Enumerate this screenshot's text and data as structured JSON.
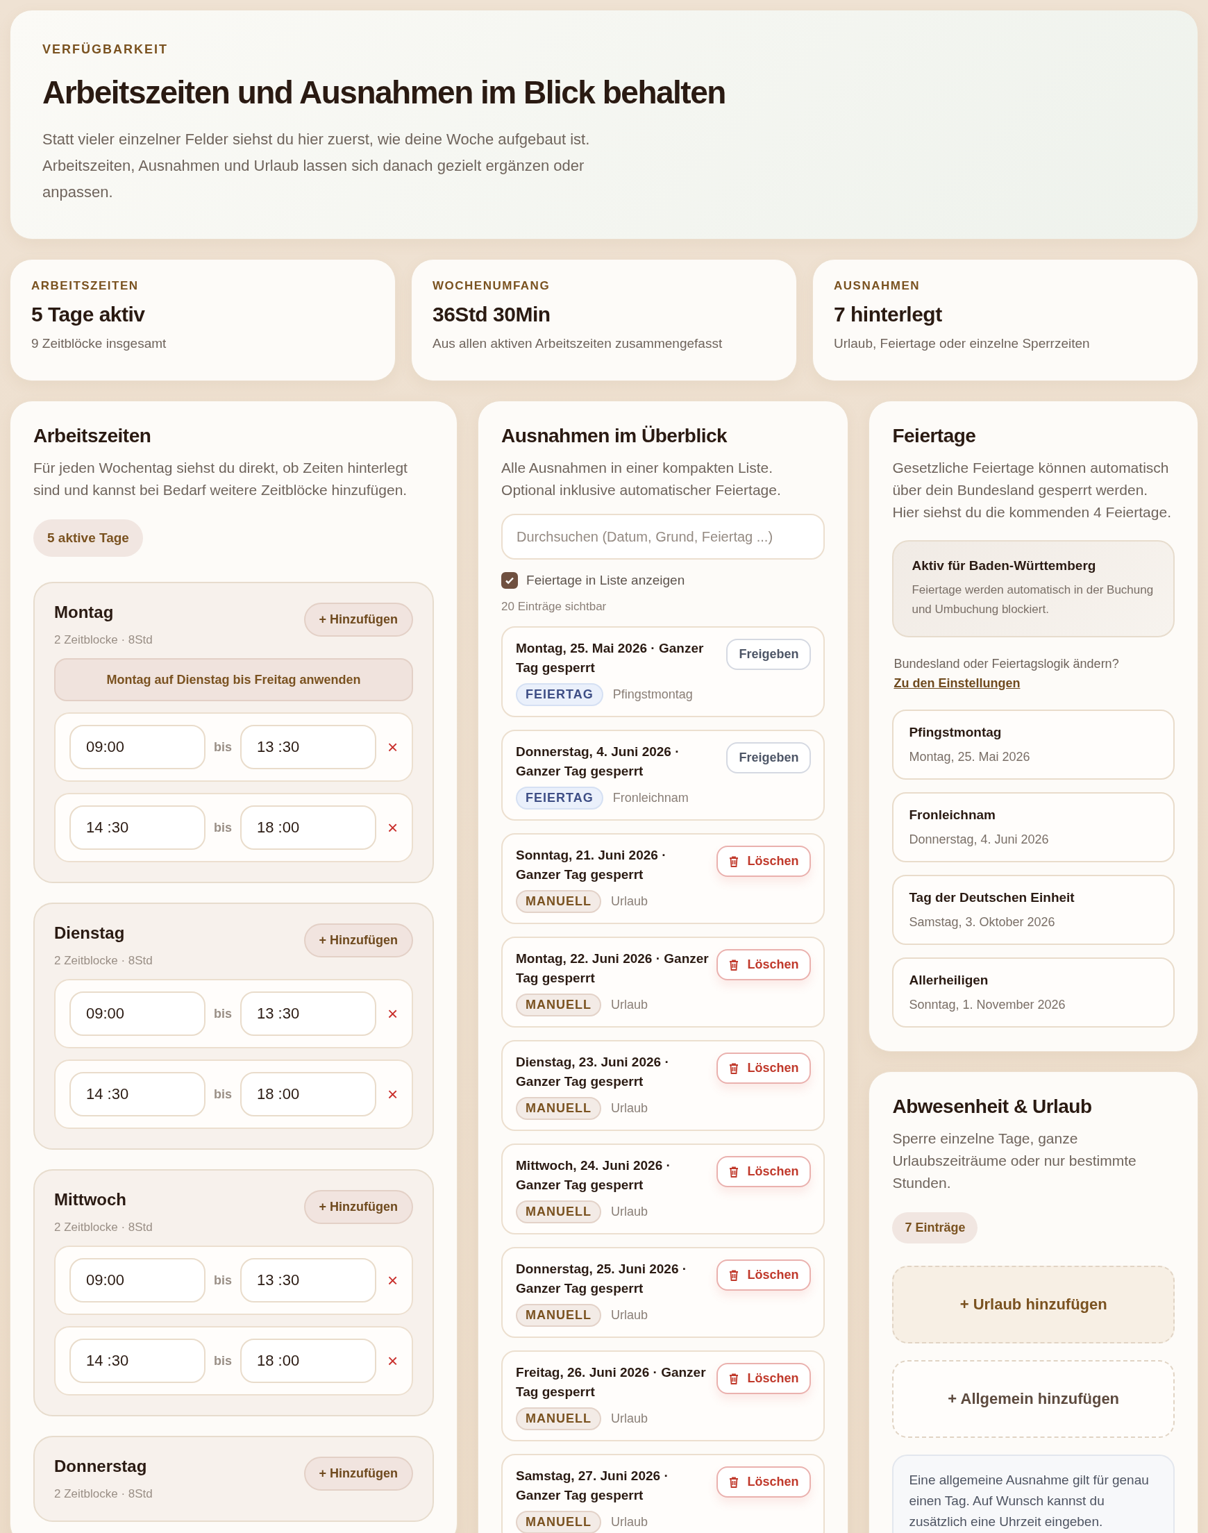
{
  "hero": {
    "eyebrow": "VERFÜGBARKEIT",
    "title": "Arbeitszeiten und Ausnahmen im Blick behalten",
    "description": "Statt vieler einzelner Felder siehst du hier zuerst, wie deine Woche aufgebaut ist. Arbeitszeiten, Ausnahmen und Urlaub lassen sich danach gezielt ergänzen oder anpassen."
  },
  "stats": [
    {
      "label": "ARBEITSZEITEN",
      "value": "5 Tage aktiv",
      "note": "9 Zeitblöcke insgesamt"
    },
    {
      "label": "WOCHENUMFANG",
      "value": "36Std 30Min",
      "note": "Aus allen aktiven Arbeitszeiten zusammengefasst"
    },
    {
      "label": "AUSNAHMEN",
      "value": "7 hinterlegt",
      "note": "Urlaub, Feiertage oder einzelne Sperrzeiten"
    }
  ],
  "working_hours": {
    "title": "Arbeitszeiten",
    "description": "Für jeden Wochentag siehst du direkt, ob Zeiten hinterlegt sind und kannst bei Bedarf weitere Zeitblöcke hinzufügen.",
    "count_pill": "5 aktive Tage",
    "days": [
      {
        "name": "Montag",
        "summary": "2 Zeitblocke · 8Std",
        "add_button": "+ Hinzufügen",
        "apply_button": "Montag auf Dienstag bis Freitag anwenden",
        "slots": [
          {
            "from": "09:00",
            "separator": "bis",
            "to": "13 :30",
            "remove": "×"
          },
          {
            "from": "14 :30",
            "separator": "bis",
            "to": "18 :00",
            "remove": "×"
          }
        ]
      },
      {
        "name": "Dienstag",
        "summary": "2 Zeitblocke · 8Std",
        "add_button": "+ Hinzufügen",
        "slots": [
          {
            "from": "09:00",
            "separator": "bis",
            "to": "13 :30",
            "remove": "×"
          },
          {
            "from": "14 :30",
            "separator": "bis",
            "to": "18 :00",
            "remove": "×"
          }
        ]
      },
      {
        "name": "Mittwoch",
        "summary": "2 Zeitblocke · 8Std",
        "add_button": "+ Hinzufügen",
        "slots": [
          {
            "from": "09:00",
            "separator": "bis",
            "to": "13 :30",
            "remove": "×"
          },
          {
            "from": "14 :30",
            "separator": "bis",
            "to": "18 :00",
            "remove": "×"
          }
        ]
      },
      {
        "name": "Donnerstag",
        "summary": "2 Zeitblocke · 8Std",
        "add_button": "+ Hinzufügen"
      }
    ]
  },
  "exceptions": {
    "title": "Ausnahmen im Überblick",
    "description": "Alle Ausnahmen in einer kompakten Liste. Optional inklusive automatischer Feiertage.",
    "search": {
      "placeholder": "Durchsuchen (Datum, Grund, Feiertag ...)"
    },
    "show_holidays": {
      "label": "Feiertage in Liste anzeigen",
      "checked": true
    },
    "visible_count": "20 Einträge sichtbar",
    "entries": [
      {
        "kind": "holiday",
        "title": "Montag, 25. Mai 2026 · Ganzer Tag gesperrt",
        "badge": "FEIERTAG",
        "reason": "Pfingstmontag",
        "action": "Freigeben"
      },
      {
        "kind": "holiday",
        "title": "Donnerstag, 4. Juni 2026 · Ganzer Tag gesperrt",
        "badge": "FEIERTAG",
        "reason": "Fronleichnam",
        "action": "Freigeben"
      },
      {
        "kind": "manual",
        "title": "Sonntag, 21. Juni 2026 · Ganzer Tag gesperrt",
        "badge": "MANUELL",
        "reason": "Urlaub",
        "action": "Löschen"
      },
      {
        "kind": "manual",
        "title": "Montag, 22. Juni 2026 · Ganzer Tag gesperrt",
        "badge": "MANUELL",
        "reason": "Urlaub",
        "action": "Löschen"
      },
      {
        "kind": "manual",
        "title": "Dienstag, 23. Juni 2026 · Ganzer Tag gesperrt",
        "badge": "MANUELL",
        "reason": "Urlaub",
        "action": "Löschen"
      },
      {
        "kind": "manual",
        "title": "Mittwoch, 24. Juni 2026 · Ganzer Tag gesperrt",
        "badge": "MANUELL",
        "reason": "Urlaub",
        "action": "Löschen"
      },
      {
        "kind": "manual",
        "title": "Donnerstag, 25. Juni 2026 · Ganzer Tag gesperrt",
        "badge": "MANUELL",
        "reason": "Urlaub",
        "action": "Löschen"
      },
      {
        "kind": "manual",
        "title": "Freitag, 26. Juni 2026 · Ganzer Tag gesperrt",
        "badge": "MANUELL",
        "reason": "Urlaub",
        "action": "Löschen"
      },
      {
        "kind": "manual",
        "title": "Samstag, 27. Juni 2026 · Ganzer Tag gesperrt",
        "badge": "MANUELL",
        "reason": "Urlaub",
        "action": "Löschen"
      }
    ]
  },
  "holidays": {
    "title": "Feiertage",
    "description": "Gesetzliche Feiertage können automatisch über dein Bundesland gesperrt werden. Hier siehst du die kommenden 4 Feiertage.",
    "notice": {
      "title": "Aktiv für Baden-Württemberg",
      "text": "Feiertage werden automatisch in der Buchung und Umbuchung blockiert."
    },
    "settings_hint": "Bundesland oder Feiertagslogik ändern?",
    "settings_link": "Zu den Einstellungen",
    "items": [
      {
        "name": "Pfingstmontag",
        "date": "Montag, 25. Mai 2026"
      },
      {
        "name": "Fronleichnam",
        "date": "Donnerstag, 4. Juni 2026"
      },
      {
        "name": "Tag der Deutschen Einheit",
        "date": "Samstag, 3. Oktober 2026"
      },
      {
        "name": "Allerheiligen",
        "date": "Sonntag, 1. November 2026"
      }
    ]
  },
  "absence": {
    "title": "Abwesenheit & Urlaub",
    "description": "Sperre einzelne Tage, ganze Urlaubszeiträume oder nur bestimmte Stunden.",
    "count_pill": "7 Einträge",
    "add_vacation": "+ Urlaub hinzufügen",
    "add_general": "+ Allgemein hinzufügen",
    "info": "Eine allgemeine Ausnahme gilt für genau einen Tag. Auf Wunsch kannst du zusätzlich eine Uhrzeit eingeben."
  }
}
